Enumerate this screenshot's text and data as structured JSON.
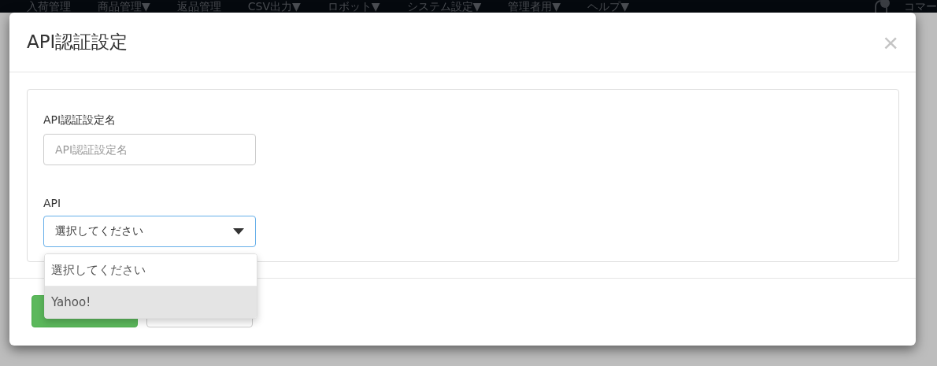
{
  "navbar": {
    "items": [
      "入荷管理",
      "商品管理▼",
      "返品管理",
      "CSV出力▼",
      "ロボット▼",
      "システム設定▼",
      "管理者用▼",
      "ヘルプ▼"
    ],
    "user": "コマー"
  },
  "modal": {
    "title": "API認証設定",
    "close": "×",
    "fields": [
      {
        "kind": "text",
        "label": "API認証設定名",
        "placeholder": "API認証設定名"
      },
      {
        "kind": "select",
        "label": "API",
        "value": "選択してください",
        "expanded": true,
        "options": [
          {
            "label": "選択してください",
            "highlighted": false
          },
          {
            "label": "Yahoo!",
            "highlighted": true
          }
        ]
      }
    ],
    "buttons": [
      {
        "kind": "primary"
      },
      {
        "kind": "default"
      }
    ]
  }
}
